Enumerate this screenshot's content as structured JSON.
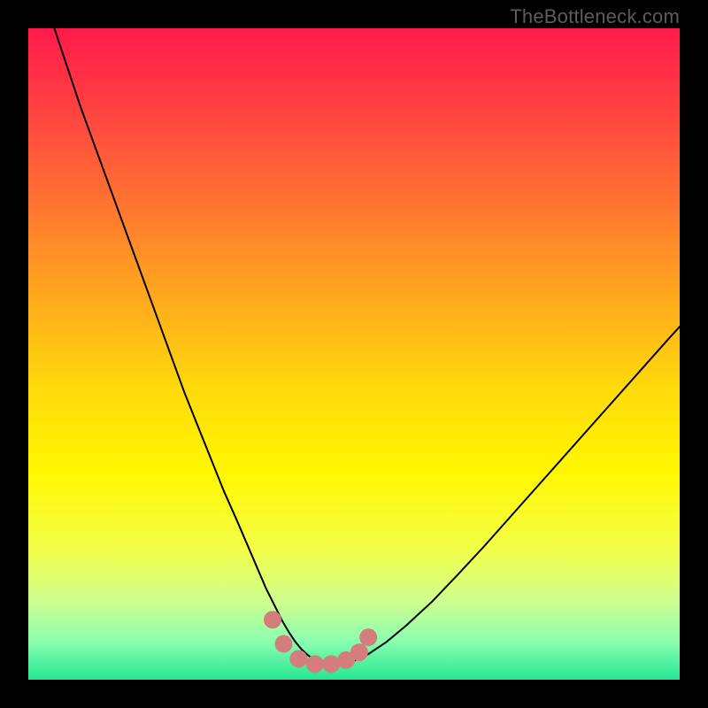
{
  "watermark": "TheBottleneck.com",
  "chart_data": {
    "type": "line",
    "title": "",
    "xlabel": "",
    "ylabel": "",
    "xlim": [
      0,
      100
    ],
    "ylim": [
      0,
      100
    ],
    "grid": false,
    "legend": false,
    "background_gradient": {
      "stops": [
        {
          "offset": 0.0,
          "color": "#ff1a4b"
        },
        {
          "offset": 0.1,
          "color": "#ff3a43"
        },
        {
          "offset": 0.25,
          "color": "#ff6d33"
        },
        {
          "offset": 0.4,
          "color": "#ffa41f"
        },
        {
          "offset": 0.55,
          "color": "#ffd90a"
        },
        {
          "offset": 0.68,
          "color": "#fff700"
        },
        {
          "offset": 0.8,
          "color": "#f3ff4a"
        },
        {
          "offset": 0.88,
          "color": "#ceff8f"
        },
        {
          "offset": 0.94,
          "color": "#8cffb0"
        },
        {
          "offset": 1.0,
          "color": "#25e692"
        }
      ]
    },
    "series": [
      {
        "name": "bottleneck-curve",
        "color": "#000000",
        "stroke_width": 2,
        "x": [
          4,
          6,
          8,
          10,
          12,
          14,
          16,
          18,
          20,
          22,
          24,
          26,
          28,
          30,
          32,
          33.5,
          35,
          36.5,
          38,
          39,
          40,
          41,
          42,
          43,
          44,
          45,
          46,
          48,
          50,
          52,
          55,
          58,
          62,
          66,
          70,
          74,
          78,
          82,
          86,
          90,
          94,
          98,
          100
        ],
        "y": [
          100,
          94,
          88,
          82.5,
          77,
          71.5,
          66,
          60.5,
          55,
          49.5,
          44,
          39,
          34,
          29,
          24.5,
          21,
          17.5,
          14,
          11,
          9,
          7.3,
          5.8,
          4.6,
          3.7,
          3.0,
          2.6,
          2.4,
          2.4,
          2.9,
          3.8,
          5.8,
          8.3,
          12.0,
          16.2,
          20.5,
          25.0,
          29.5,
          34.0,
          38.5,
          43.0,
          47.5,
          52.0,
          54.2
        ]
      },
      {
        "name": "flat-bottom-markers",
        "color": "#d47d7d",
        "type": "scatter",
        "marker_radius": 10,
        "x": [
          37.5,
          39.2,
          41.5,
          44.0,
          46.5,
          48.8,
          50.8,
          52.2
        ],
        "y": [
          9.2,
          5.5,
          3.2,
          2.4,
          2.4,
          3.0,
          4.2,
          6.5
        ]
      }
    ]
  }
}
